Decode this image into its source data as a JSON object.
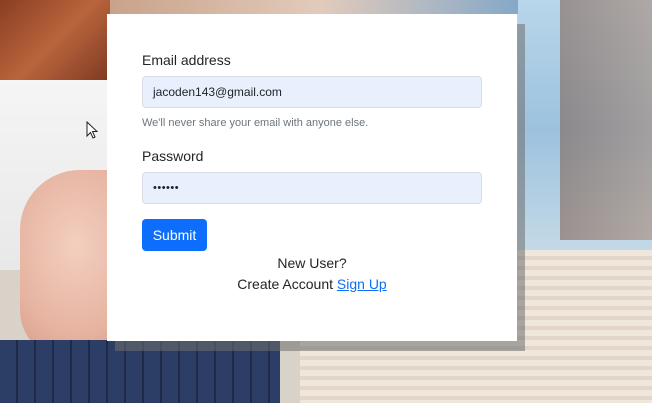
{
  "form": {
    "email_label": "Email address",
    "email_value": "jacoden143@gmail.com",
    "email_help": "We'll never share your email with anyone else.",
    "password_label": "Password",
    "password_value": "••••••",
    "submit_label": "Submit",
    "new_user_text": "New User?",
    "create_account_text": "Create Account",
    "signup_link": "Sign Up"
  },
  "colors": {
    "primary": "#0d6efd",
    "input_bg": "#e8f0fe"
  },
  "icons": {
    "cursor": "mouse-pointer-icon"
  }
}
